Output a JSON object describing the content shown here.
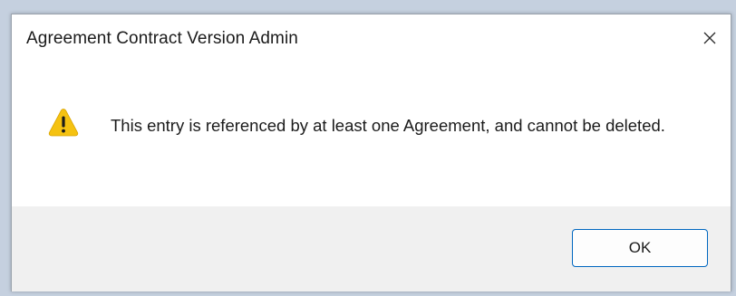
{
  "dialog": {
    "title": "Agreement Contract Version Admin",
    "close_icon": "close-icon",
    "warning_icon": "warning-icon",
    "message": "This entry is referenced by at least one Agreement, and cannot be deleted.",
    "ok_label": "OK"
  },
  "colors": {
    "accent": "#0067c0",
    "warning_fill": "#f5c211",
    "footer_bg": "#f0f0f0"
  }
}
